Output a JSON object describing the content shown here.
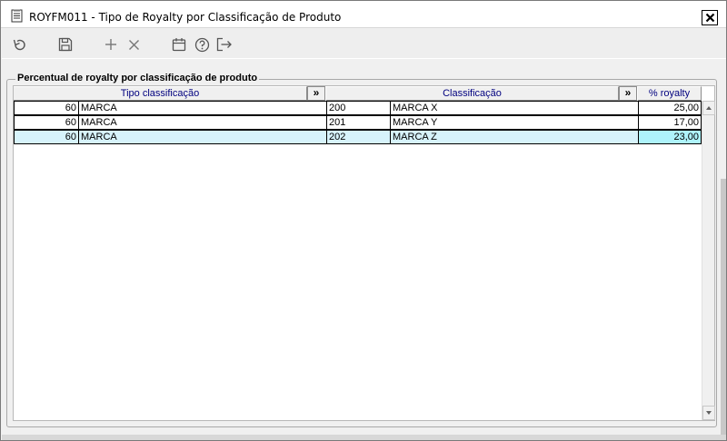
{
  "window": {
    "title": "ROYFM011 - Tipo de Royalty por Classificação de Produto",
    "icon": "document-icon",
    "close_icon": "close-icon"
  },
  "toolbar": {
    "items": [
      {
        "name": "undo",
        "icon": "undo-icon"
      },
      {
        "name": "save",
        "icon": "save-icon"
      },
      {
        "name": "add",
        "icon": "plus-icon"
      },
      {
        "name": "delete",
        "icon": "x-icon"
      },
      {
        "name": "calendar",
        "icon": "calendar-icon"
      },
      {
        "name": "help",
        "icon": "help-icon"
      },
      {
        "name": "exit",
        "icon": "exit-icon"
      }
    ]
  },
  "group": {
    "label": "Percentual de royalty por classificação de produto"
  },
  "grid": {
    "headers": {
      "tipo": "Tipo classificação",
      "tipo_btn": "»",
      "classificacao": "Classificação",
      "classificacao_btn": "»",
      "royalty": "% royalty"
    },
    "rows": [
      {
        "tipo_code": "60",
        "tipo_name": "MARCA",
        "class_code": "200",
        "class_name": "MARCA X",
        "royalty": "25,00"
      },
      {
        "tipo_code": "60",
        "tipo_name": "MARCA",
        "class_code": "201",
        "class_name": "MARCA Y",
        "royalty": "17,00"
      },
      {
        "tipo_code": "60",
        "tipo_name": "MARCA",
        "class_code": "202",
        "class_name": "MARCA Z",
        "royalty": "23,00"
      }
    ],
    "selected_row": 3
  },
  "colors": {
    "header_text": "#00007f",
    "selected_row": "#d7f3fb",
    "focused_cell": "#aef3fb"
  }
}
